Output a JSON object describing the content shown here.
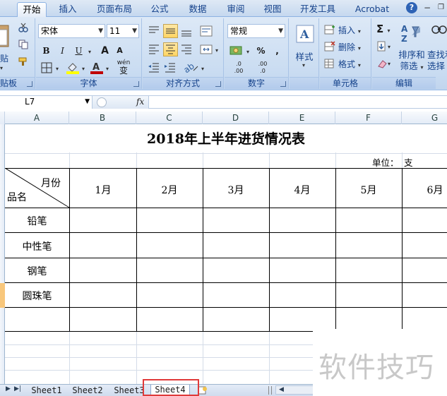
{
  "ribbon_tabs": [
    "开始",
    "插入",
    "页面布局",
    "公式",
    "数据",
    "审阅",
    "视图",
    "开发工具",
    "Acrobat"
  ],
  "window": {
    "help": "?",
    "minimize": "−"
  },
  "clipboard": {
    "paste": "贴",
    "label": "贴板"
  },
  "font_group": {
    "font_name": "宋体",
    "font_size": "11",
    "bold": "B",
    "italic": "I",
    "underline": "U",
    "grow": "A",
    "shrink": "A",
    "wen": "wén",
    "wen_char": "变",
    "label": "字体",
    "font_color": "#c00000",
    "fill_color": "#ffff00"
  },
  "align_group": {
    "label": "对齐方式"
  },
  "number_group": {
    "format": "常规",
    "percent": "%",
    "comma": ",",
    "inc": ".0",
    "inc2": ".00",
    "dec": ".00",
    "dec2": ".0",
    "label": "数字"
  },
  "styles_group": {
    "label": "样式"
  },
  "cells_group": {
    "insert": "插入",
    "delete": "删除",
    "format": "格式",
    "label": "单元格"
  },
  "edit_group": {
    "sum": "Σ",
    "sort": "排序和",
    "sort2": "筛选",
    "find": "查找和",
    "find2": "选择",
    "label": "编辑"
  },
  "formula_bar": {
    "name_box": "L7",
    "fx": "fx"
  },
  "columns": [
    "A",
    "B",
    "C",
    "D",
    "E",
    "F",
    "G"
  ],
  "table": {
    "title": "2018年上半年进货情况表",
    "unit_label": "单位：",
    "unit_value": "支",
    "corner_top": "月份",
    "corner_bottom": "品名",
    "months": [
      "1月",
      "2月",
      "3月",
      "4月",
      "5月",
      "6月"
    ],
    "items": [
      "铅笔",
      "中性笔",
      "钢笔",
      "圆珠笔",
      ""
    ]
  },
  "sheet_tabs": [
    "Sheet1",
    "Sheet2",
    "Sheet3",
    "Sheet4"
  ],
  "active_sheet": "Sheet4",
  "watermark": "软件技巧"
}
